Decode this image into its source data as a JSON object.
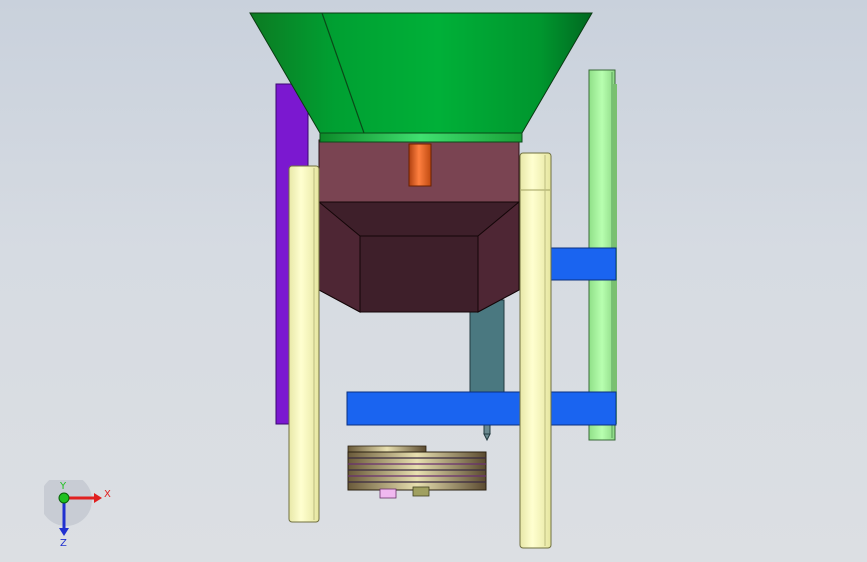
{
  "viewport": {
    "background_top": "#c9d1dc",
    "background_bottom": "#dcdfe3"
  },
  "model": {
    "hopper_color": "#00a032",
    "housing_color": "#7a4452",
    "lower_housing_color": "#3e1f2a",
    "rod_color": "#e06020",
    "frame_post_color": "#ffffc0",
    "side_plate_color": "#7b18d0",
    "right_plate_color": "#a8f0a0",
    "beam_color": "#1a64f0",
    "shaft_color": "#4a7880"
  },
  "triad": {
    "x_label": "X",
    "y_label": "Y",
    "z_label": "Z",
    "x_color": "#e02020",
    "y_color": "#20c020",
    "z_color": "#2030d0"
  }
}
